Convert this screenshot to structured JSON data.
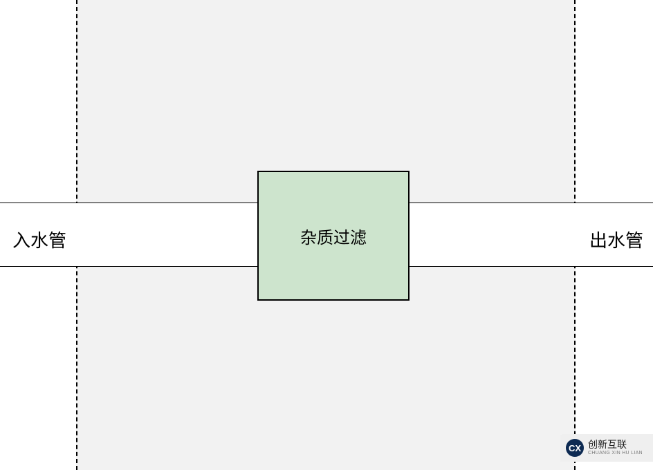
{
  "diagram": {
    "inlet_label": "入水管",
    "outlet_label": "出水管",
    "filter_label": "杂质过滤"
  },
  "watermark": {
    "icon_text": "CX",
    "brand_cn": "创新互联",
    "brand_en": "CHUANG XIN HU LIAN"
  }
}
